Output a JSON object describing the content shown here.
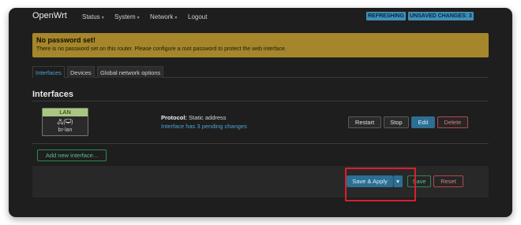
{
  "nav": {
    "brand": "OpenWrt",
    "items": [
      {
        "label": "Status"
      },
      {
        "label": "System"
      },
      {
        "label": "Network"
      },
      {
        "label": "Logout"
      }
    ],
    "caret": "▾",
    "refreshing": "REFRESHING",
    "unsaved": "UNSAVED CHANGES: 3"
  },
  "alert": {
    "title": "No password set!",
    "text": "There is no password set on this router. Please configure a root password to protect the web interface."
  },
  "tabs": [
    {
      "label": "Interfaces"
    },
    {
      "label": "Devices"
    },
    {
      "label": "Global network options"
    }
  ],
  "section": {
    "title": "Interfaces"
  },
  "interface": {
    "name": "LAN",
    "icons": "🖧(🖵)",
    "device": "br-lan",
    "protocol_label": "Protocol:",
    "protocol_value": "Static address",
    "pending": "Interface has 3 pending changes"
  },
  "buttons": {
    "restart": "Restart",
    "stop": "Stop",
    "edit": "Edit",
    "delete": "Delete",
    "add": "Add new interface...",
    "save_apply": "Save & Apply",
    "dropdown": "▾",
    "save": "Save",
    "reset": "Reset"
  },
  "colors": {
    "accent": "#3f8fb8",
    "warning": "#a5862b",
    "lan_badge": "#a8c87f",
    "highlight": "#d9202a"
  }
}
